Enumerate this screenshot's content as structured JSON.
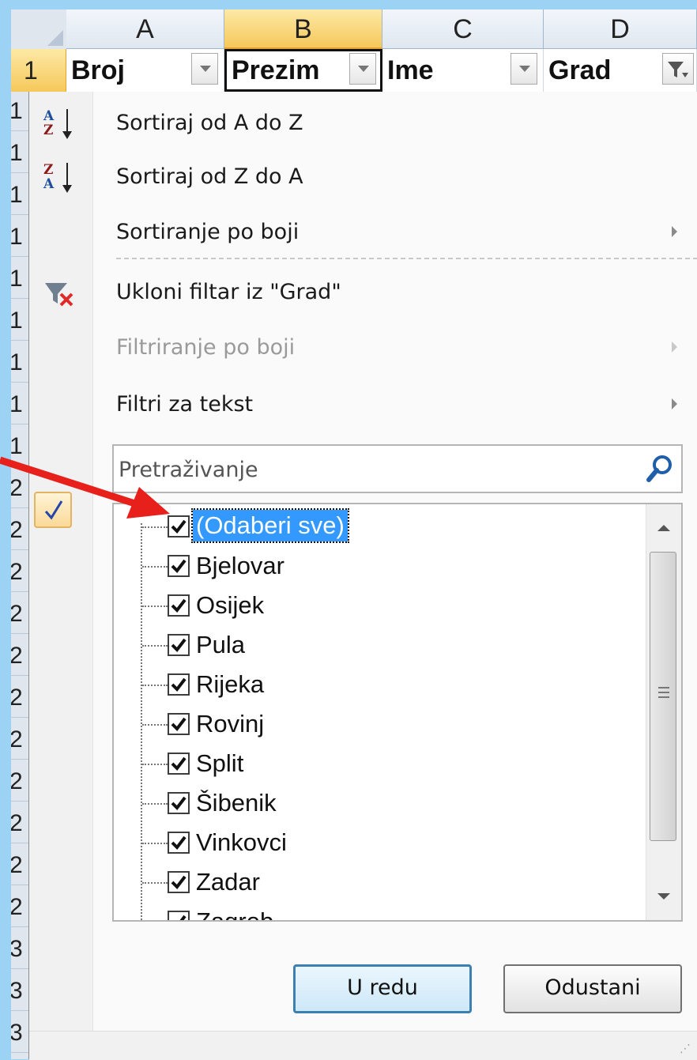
{
  "sheet": {
    "columns": [
      "A",
      "B",
      "C",
      "D"
    ],
    "row_number": "1",
    "headers": [
      "Broj",
      "Prezim",
      "Ime",
      "Grad"
    ],
    "row_digits": [
      "1",
      "1",
      "1",
      "1",
      "1",
      "1",
      "1",
      "1",
      "1",
      "2",
      "2",
      "2",
      "2",
      "2",
      "2",
      "2",
      "2",
      "2",
      "2",
      "2",
      "3",
      "3",
      "3"
    ]
  },
  "menu": {
    "sort_az": "Sortiraj od A do Z",
    "sort_za": "Sortiraj od Z do A",
    "sort_color": "Sortiranje po boji",
    "clear_filter": "Ukloni filtar iz \"Grad\"",
    "filter_color": "Filtriranje po boji",
    "text_filters": "Filtri za tekst",
    "search_placeholder": "Pretraživanje",
    "items": [
      {
        "label": "(Odaberi sve)",
        "checked": true,
        "selected": true
      },
      {
        "label": "Bjelovar",
        "checked": true
      },
      {
        "label": "Osijek",
        "checked": true
      },
      {
        "label": "Pula",
        "checked": true
      },
      {
        "label": "Rijeka",
        "checked": true
      },
      {
        "label": "Rovinj",
        "checked": true
      },
      {
        "label": "Split",
        "checked": true
      },
      {
        "label": "Šibenik",
        "checked": true
      },
      {
        "label": "Vinkovci",
        "checked": true
      },
      {
        "label": "Zadar",
        "checked": true
      },
      {
        "label": "Zagreb",
        "checked": true
      }
    ],
    "ok_label": "U redu",
    "cancel_label": "Odustani"
  },
  "colors": {
    "background": "#9cd3f5",
    "selection": "#3399ff",
    "annotation_arrow": "#e8201c"
  }
}
